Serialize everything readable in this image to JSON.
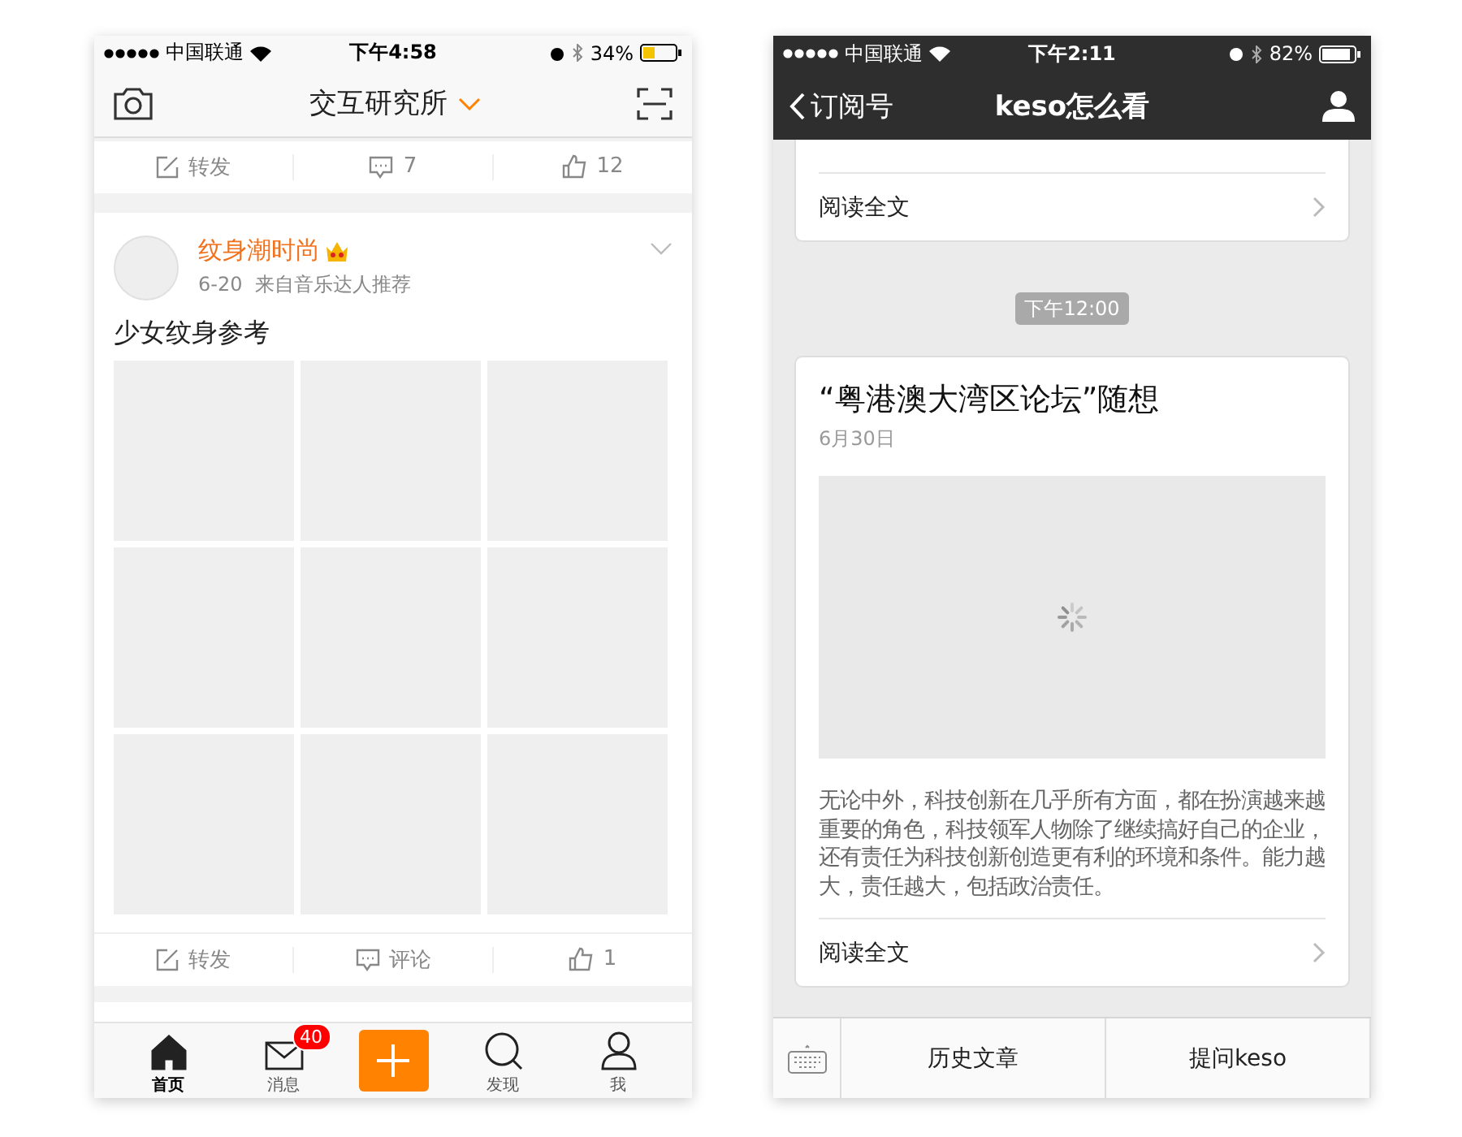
{
  "feed_phone": {
    "status_bar": {
      "carrier": "中国联通",
      "time": "下午4:58",
      "battery": "34%"
    },
    "nav": {
      "title": "交互研究所"
    },
    "top_actions": [
      {
        "kind": "repost",
        "label": "转发"
      },
      {
        "kind": "comment",
        "label": "7"
      },
      {
        "kind": "like",
        "label": "12"
      }
    ],
    "post": {
      "author": "纹身潮时尚",
      "meta": "6-20  来自音乐达人推荐",
      "text": "少女纹身参考",
      "images": [
        {
          "kind": "placeholder"
        },
        {
          "kind": "placeholder"
        },
        {
          "kind": "placeholder"
        },
        {
          "kind": "placeholder"
        },
        {
          "kind": "placeholder"
        },
        {
          "kind": "placeholder"
        },
        {
          "kind": "placeholder"
        },
        {
          "kind": "placeholder"
        },
        {
          "kind": "placeholder"
        }
      ],
      "actions": [
        {
          "kind": "repost",
          "label": "转发"
        },
        {
          "kind": "comment",
          "label": "评论"
        },
        {
          "kind": "like",
          "label": "1"
        }
      ]
    },
    "tab_bar": [
      {
        "kind": "home",
        "label": "首页",
        "selected": true
      },
      {
        "kind": "mail",
        "label": "消息",
        "badge": "40",
        "selected": false
      },
      {
        "kind": "compose"
      },
      {
        "kind": "search",
        "label": "发现",
        "selected": false
      },
      {
        "kind": "profile",
        "label": "我",
        "selected": false
      }
    ]
  },
  "chat_phone": {
    "status_bar": {
      "carrier": "中国联通",
      "time": "下午2:11",
      "battery": "82%"
    },
    "nav": {
      "back": "订阅号",
      "title": "keso怎么看"
    },
    "previous_card": {
      "read_more": "阅读全文"
    },
    "time_pill": "下午12:00",
    "article": {
      "title": "“粤港澳大湾区论坛”随想",
      "date": "6月30日",
      "excerpt": "无论中外，科技创新在几乎所有方面，都在扮演越来越重要的角色，科技领军人物除了继续搞好自己的企业，还有责任为科技创新创造更有利的环境和条件。能力越大，责任越大，包括政治责任。",
      "read_more": "阅读全文"
    },
    "bottom_menu": [
      {
        "label": "历史文章"
      },
      {
        "label": "提问keso"
      }
    ]
  }
}
